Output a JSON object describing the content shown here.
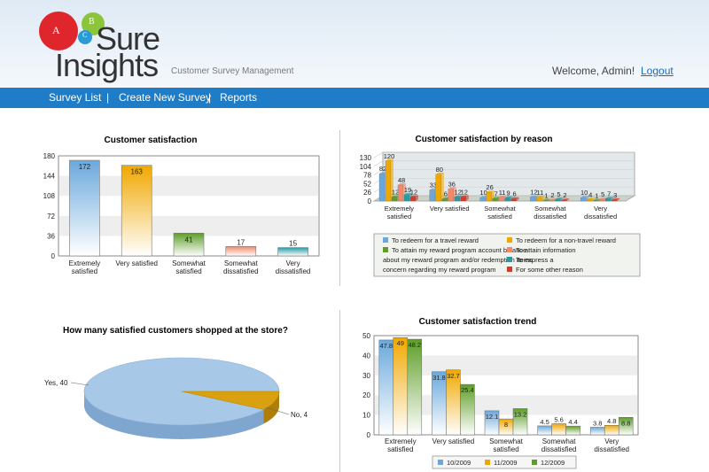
{
  "header": {
    "logo": {
      "letters": [
        "A",
        "B",
        "C"
      ],
      "brand_line1": "Sure",
      "brand_line2": "Insights"
    },
    "tagline": "Customer Survey Management",
    "welcome": "Welcome, Admin!",
    "logout": "Logout"
  },
  "nav": {
    "items": [
      "Survey List",
      "|",
      "Create New Survey",
      "|",
      "Reports"
    ]
  },
  "colors": {
    "blue": "#6aa8dc",
    "orange": "#f0a800",
    "green": "#5e9e28",
    "salmon": "#f08a6a",
    "teal": "#2a9aa2",
    "red": "#d43a2a",
    "navbar": "#1f7dc8"
  },
  "chart_data": [
    {
      "type": "bar",
      "title": "Customer satisfaction",
      "categories": [
        "Extremely satisfied",
        "Very satisfied",
        "Somewhat satisfied",
        "Somewhat dissatisfied",
        "Very dissatisfied"
      ],
      "category_lines": [
        [
          "Extremely",
          "satisfied"
        ],
        [
          "Very satisfied"
        ],
        [
          "Somewhat",
          "satisfied"
        ],
        [
          "Somewhat",
          "dissatisfied"
        ],
        [
          "Very",
          "dissatisfied"
        ]
      ],
      "values": [
        172,
        163,
        41,
        17,
        15
      ],
      "value_labels": [
        "172",
        "163",
        "41",
        "17",
        "15"
      ],
      "yticks": [
        "0",
        "36",
        "72",
        "108",
        "144",
        "180"
      ],
      "ylim": [
        0,
        180
      ],
      "colors": [
        "#6aa8dc",
        "#f0a800",
        "#5e9e28",
        "#f08a6a",
        "#2a9aa2"
      ]
    },
    {
      "type": "bar",
      "title": "Customer satisfaction by reason",
      "categories": [
        "Extremely satisfied",
        "Very satisfied",
        "Somewhat satisfied",
        "Somewhat dissatisfied",
        "Very dissatisfied"
      ],
      "category_lines": [
        [
          "Extremely",
          "satisfied"
        ],
        [
          "Very satisfied"
        ],
        [
          "Somewhat",
          "satisfied"
        ],
        [
          "Somewhat",
          "dissatisfied"
        ],
        [
          "Very",
          "dissatisfied"
        ]
      ],
      "yticks": [
        "0",
        "26",
        "52",
        "78",
        "104",
        "130"
      ],
      "ylim": [
        0,
        130
      ],
      "series": [
        {
          "name": "To redeem for a travel reward",
          "values": [
            82,
            33,
            10,
            12,
            10
          ]
        },
        {
          "name": "To redeem for a non-travel reward",
          "values": [
            120,
            80,
            26,
            11,
            4
          ]
        },
        {
          "name": "To attain my reward program account balance",
          "values": [
            12,
            6,
            7,
            1,
            1
          ]
        },
        {
          "name": "To attain information about my reward program and/or redemption items",
          "values": [
            48,
            36,
            11,
            2,
            5
          ]
        },
        {
          "name": "To express a concern regarding my reward program",
          "values": [
            19,
            12,
            9,
            5,
            7
          ]
        },
        {
          "name": "For some other reason",
          "values": [
            12,
            12,
            6,
            2,
            3
          ]
        }
      ],
      "series_colors": [
        "#6aa8dc",
        "#f0a800",
        "#5e9e28",
        "#f08a6a",
        "#2a9aa2",
        "#d43a2a"
      ],
      "value_labels": [
        [
          "82",
          "120",
          "12",
          "48",
          "19",
          "12"
        ],
        [
          "33",
          "80",
          "6",
          "36",
          "12",
          "12"
        ],
        [
          "10",
          "26",
          "7",
          "11",
          "9",
          "6"
        ],
        [
          "12",
          "11",
          "1",
          "2",
          "5",
          "2"
        ],
        [
          "10",
          "4",
          "1",
          "5",
          "7",
          "3"
        ]
      ],
      "legend_lines": [
        [
          {
            "s": 0,
            "text": "To redeem for a travel reward"
          },
          {
            "s": 1,
            "text": "To redeem for a non-travel reward"
          }
        ],
        [
          {
            "s": 2,
            "text": "To attain my reward program account balance"
          },
          {
            "s": 3,
            "text": "To attain information"
          }
        ],
        [
          {
            "s": -1,
            "text": "about my reward program and/or redemption items"
          },
          {
            "s": 4,
            "text": "To express a"
          }
        ],
        [
          {
            "s": -1,
            "text": "concern regarding my reward program"
          },
          {
            "s": 5,
            "text": "For some other reason"
          }
        ]
      ]
    },
    {
      "type": "pie",
      "title": "How many satisfied customers shopped at the store?",
      "slices": [
        {
          "label": "Yes",
          "value": 40,
          "text": "Yes, 40"
        },
        {
          "label": "No",
          "value": 4,
          "text": "No, 4"
        }
      ],
      "colors": [
        "#a8c8e8",
        "#d9a010"
      ]
    },
    {
      "type": "bar",
      "title": "Customer satisfaction trend",
      "categories": [
        "Extremely satisfied",
        "Very satisfied",
        "Somewhat satisfied",
        "Somewhat dissatisfied",
        "Very dissatisfied"
      ],
      "category_lines": [
        [
          "Extremely",
          "satisfied"
        ],
        [
          "Very satisfied"
        ],
        [
          "Somewhat",
          "satisfied"
        ],
        [
          "Somewhat",
          "dissatisfied"
        ],
        [
          "Very",
          "dissatisfied"
        ]
      ],
      "yticks": [
        "0",
        "10",
        "20",
        "30",
        "40",
        "50"
      ],
      "ylim": [
        0,
        50
      ],
      "series": [
        {
          "name": "10/2009",
          "values": [
            47.8,
            31.8,
            12.1,
            4.5,
            3.8
          ]
        },
        {
          "name": "11/2009",
          "values": [
            49,
            32.7,
            8,
            5.6,
            4.8
          ]
        },
        {
          "name": "12/2009",
          "values": [
            48.2,
            25.4,
            13.2,
            4.4,
            8.8
          ]
        }
      ],
      "value_labels": [
        [
          "47.8",
          "49",
          "48.2"
        ],
        [
          "31.8",
          "32.7",
          "25.4"
        ],
        [
          "12.1",
          "8",
          "13.2"
        ],
        [
          "4.5",
          "5.6",
          "4.4"
        ],
        [
          "3.8",
          "4.8",
          "8.8"
        ]
      ],
      "series_colors": [
        "#6aa8dc",
        "#f0a800",
        "#5e9e28"
      ],
      "legend": "bottom"
    }
  ]
}
